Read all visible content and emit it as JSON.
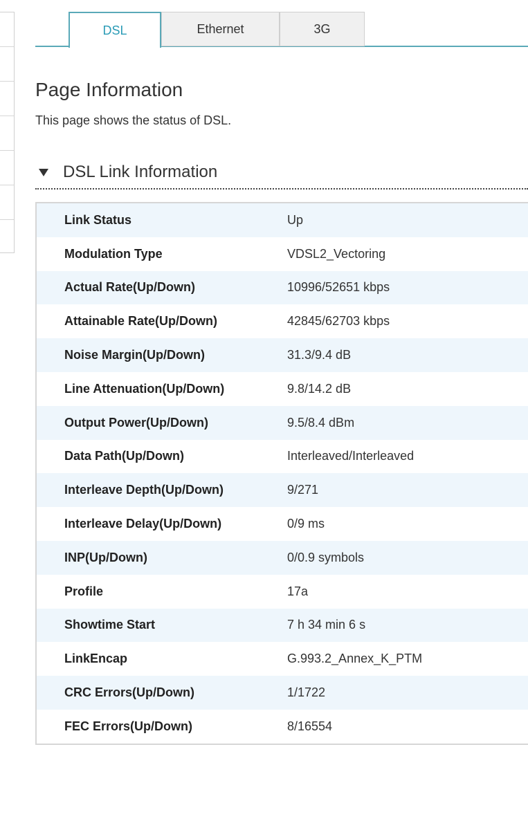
{
  "tabs": [
    {
      "label": "DSL",
      "active": true
    },
    {
      "label": "Ethernet",
      "active": false
    },
    {
      "label": "3G",
      "active": false
    }
  ],
  "page": {
    "title": "Page Information",
    "description": "This page shows the status of DSL."
  },
  "section": {
    "title": "DSL Link Information",
    "toggle_icon": "triangle-down-icon"
  },
  "rows": [
    {
      "label": "Link Status",
      "value": "Up"
    },
    {
      "label": "Modulation Type",
      "value": "VDSL2_Vectoring"
    },
    {
      "label": "Actual Rate(Up/Down)",
      "value": "10996/52651 kbps"
    },
    {
      "label": "Attainable Rate(Up/Down)",
      "value": "42845/62703 kbps"
    },
    {
      "label": "Noise Margin(Up/Down)",
      "value": "31.3/9.4 dB"
    },
    {
      "label": "Line Attenuation(Up/Down)",
      "value": "9.8/14.2 dB"
    },
    {
      "label": "Output Power(Up/Down)",
      "value": "9.5/8.4 dBm"
    },
    {
      "label": "Data Path(Up/Down)",
      "value": "Interleaved/Interleaved"
    },
    {
      "label": "Interleave Depth(Up/Down)",
      "value": "9/271"
    },
    {
      "label": "Interleave Delay(Up/Down)",
      "value": "0/9 ms"
    },
    {
      "label": "INP(Up/Down)",
      "value": "0/0.9 symbols"
    },
    {
      "label": "Profile",
      "value": "17a"
    },
    {
      "label": "Showtime Start",
      "value": "7 h 34 min 6 s"
    },
    {
      "label": "LinkEncap",
      "value": "G.993.2_Annex_K_PTM"
    },
    {
      "label": "CRC Errors(Up/Down)",
      "value": "1/1722"
    },
    {
      "label": "FEC Errors(Up/Down)",
      "value": "8/16554"
    }
  ],
  "colors": {
    "accent": "#2a9bb6",
    "tab_border": "#5aa9b8",
    "row_stripe": "#eef6fc"
  }
}
